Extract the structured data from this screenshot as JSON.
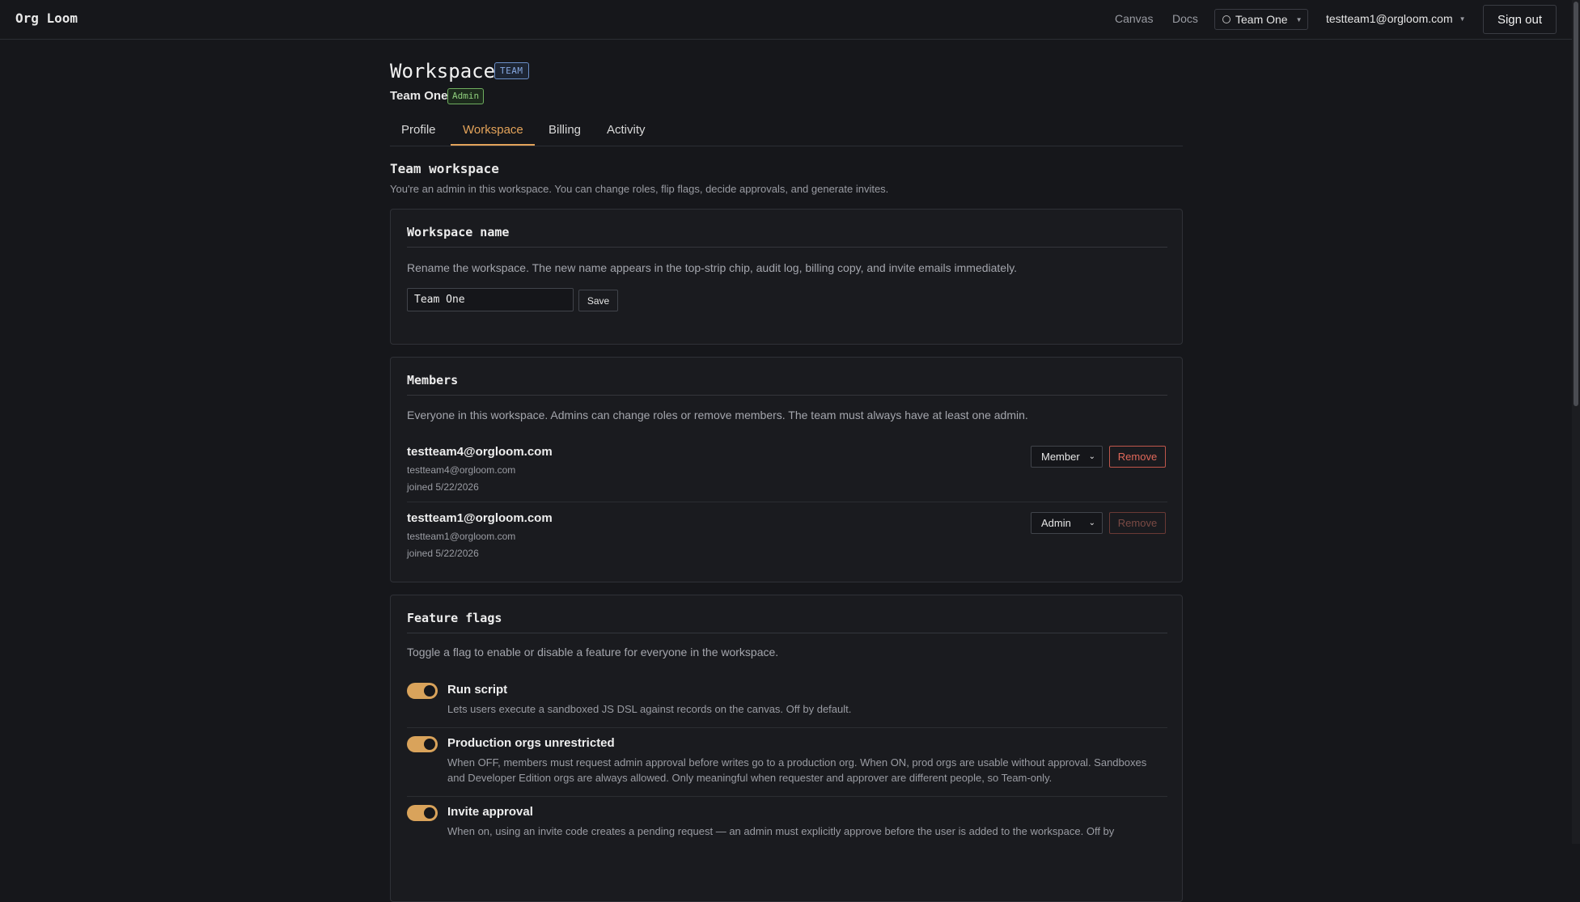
{
  "app": {
    "brand": "Org Loom",
    "nav": {
      "canvas": "Canvas",
      "docs": "Docs"
    },
    "team_switcher": {
      "label": "Team One",
      "icon": "team-icon"
    },
    "user": {
      "email": "testteam1@orgloom.com"
    },
    "sign_out": "Sign out"
  },
  "header": {
    "title": "Workspace",
    "badge": "TEAM",
    "team_name": "Team One",
    "role_badge": "Admin"
  },
  "tabs": [
    {
      "label": "Profile",
      "active": false
    },
    {
      "label": "Workspace",
      "active": true
    },
    {
      "label": "Billing",
      "active": false
    },
    {
      "label": "Activity",
      "active": false
    }
  ],
  "section": {
    "title": "Team workspace",
    "description": "You're an admin in this workspace. You can change roles, flip flags, decide approvals, and generate invites."
  },
  "workspace_name_card": {
    "title": "Workspace name",
    "description": "Rename the workspace. The new name appears in the top-strip chip, audit log, billing copy, and invite emails immediately.",
    "input_value": "Team One",
    "save_label": "Save"
  },
  "members_card": {
    "title": "Members",
    "description": "Everyone in this workspace. Admins can change roles or remove members. The team must always have at least one admin.",
    "members": [
      {
        "name": "testteam4@orgloom.com",
        "email": "testteam4@orgloom.com",
        "joined": "joined 5/22/2026",
        "role": "Member",
        "remove_label": "Remove",
        "remove_enabled": true
      },
      {
        "name": "testteam1@orgloom.com",
        "email": "testteam1@orgloom.com",
        "joined": "joined 5/22/2026",
        "role": "Admin",
        "remove_label": "Remove",
        "remove_enabled": false
      }
    ]
  },
  "flags_card": {
    "title": "Feature flags",
    "description": "Toggle a flag to enable or disable a feature for everyone in the workspace.",
    "flags": [
      {
        "title": "Run script",
        "description": "Lets users execute a sandboxed JS DSL against records on the canvas. Off by default.",
        "enabled": true
      },
      {
        "title": "Production orgs unrestricted",
        "description": "When OFF, members must request admin approval before writes go to a production org. When ON, prod orgs are usable without approval. Sandboxes and Developer Edition orgs are always allowed. Only meaningful when requester and approver are different people, so Team-only.",
        "enabled": true
      },
      {
        "title": "Invite approval",
        "description": "When on, using an invite code creates a pending request — an admin must explicitly approve before the user is added to the workspace. Off by",
        "enabled": true
      }
    ]
  },
  "colors": {
    "accent": "#e3a35a",
    "background": "#16171b",
    "danger": "#e0685a",
    "team_badge": "#86a8e0",
    "admin_badge": "#8fcf7d"
  }
}
